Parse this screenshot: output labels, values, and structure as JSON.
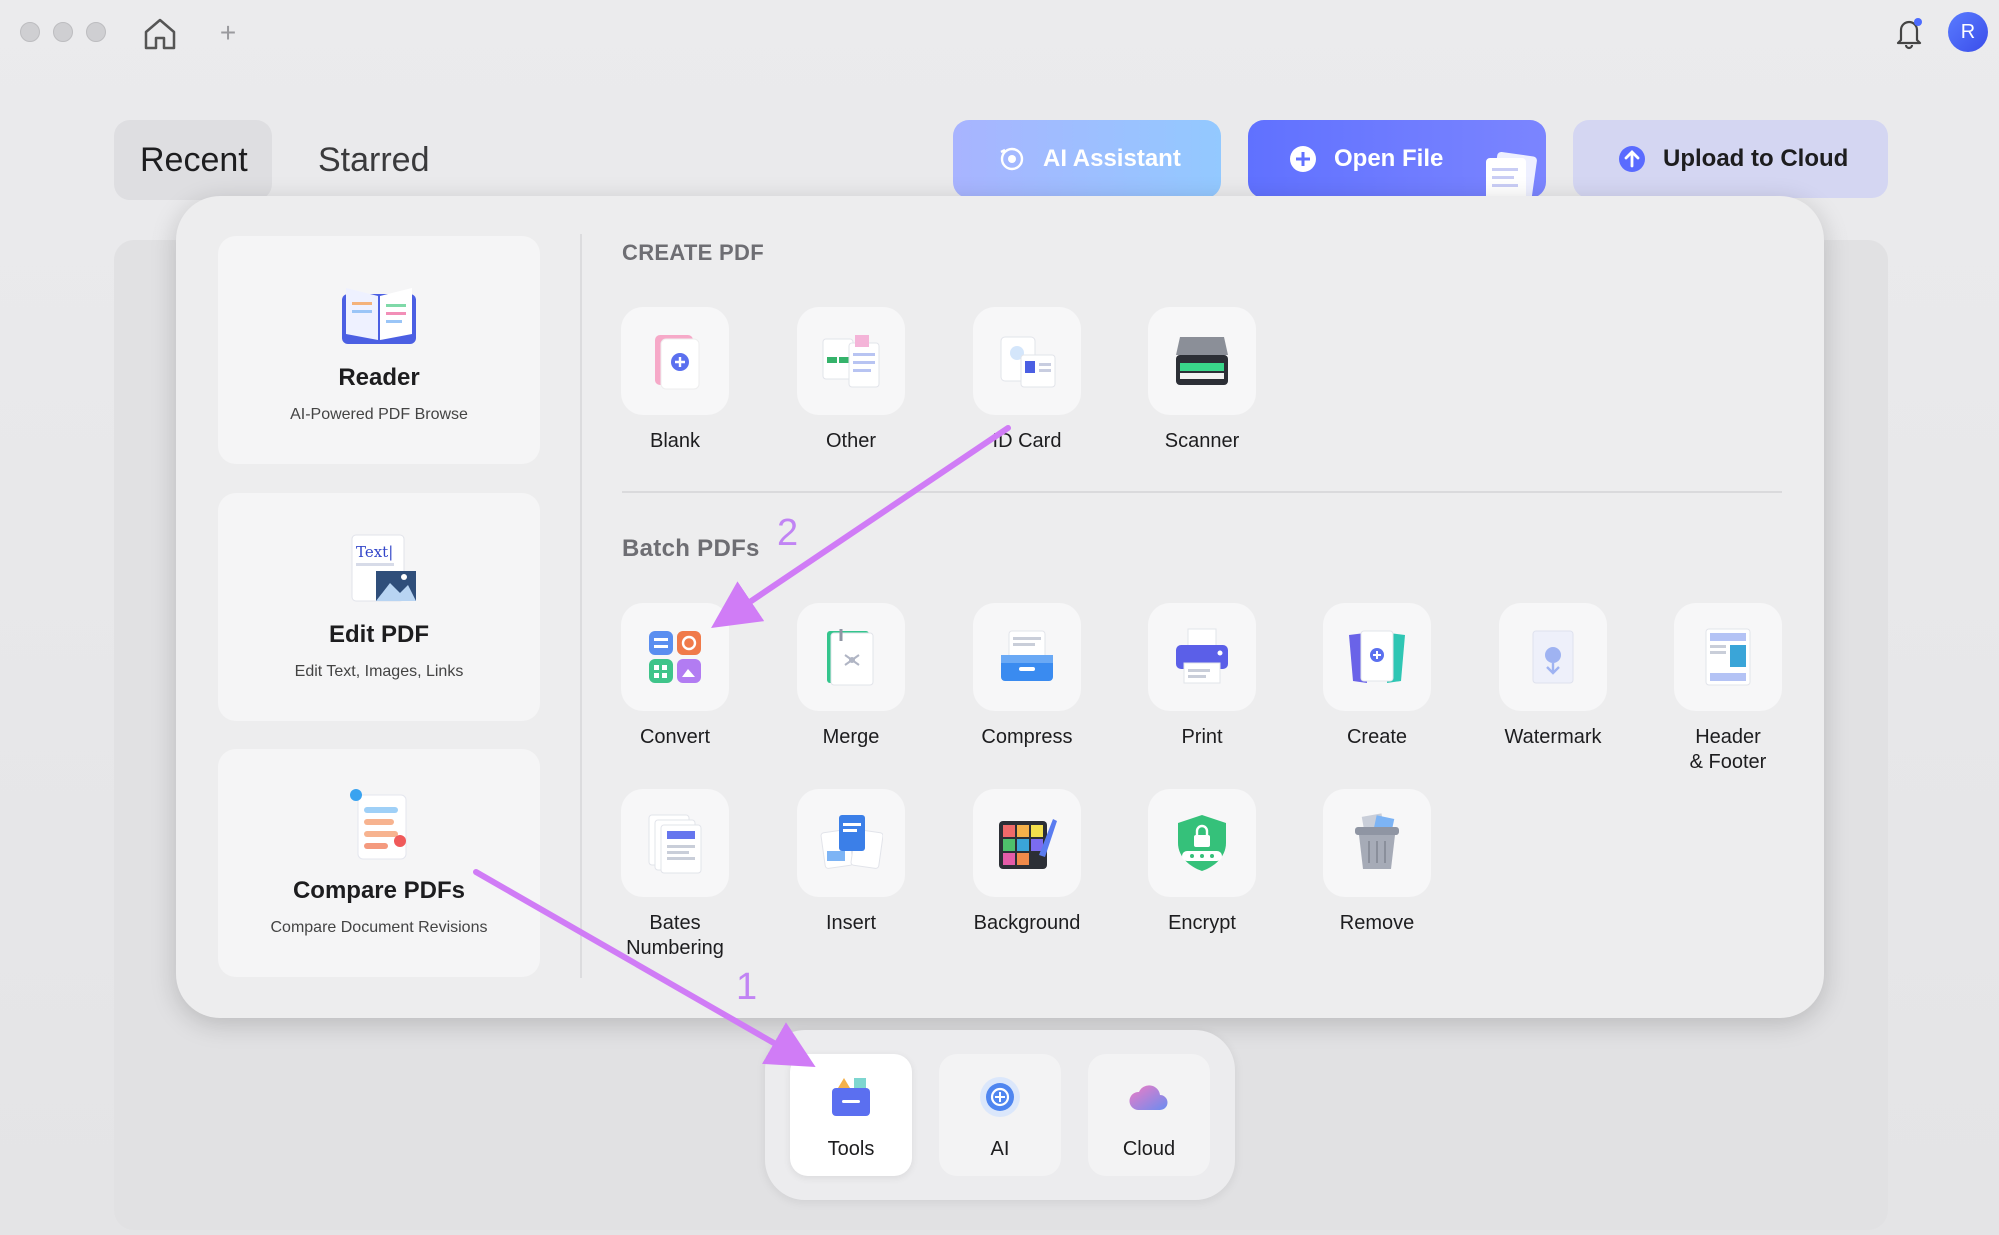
{
  "titlebar": {
    "avatar_initial": "R",
    "icons": [
      "home-icon",
      "plus-icon",
      "bell-icon"
    ]
  },
  "tabs": [
    {
      "label": "Recent",
      "active": true
    },
    {
      "label": "Starred",
      "active": false
    }
  ],
  "actions": {
    "ai_assistant": "AI Assistant",
    "open_file": "Open File",
    "upload_to_cloud": "Upload to Cloud"
  },
  "side_cards": [
    {
      "title": "Reader",
      "subtitle": "AI-Powered PDF Browse",
      "icon": "reader-icon"
    },
    {
      "title": "Edit PDF",
      "subtitle": "Edit Text, Images, Links",
      "icon": "edit-pdf-icon",
      "illustration_text": "Text|"
    },
    {
      "title": "Compare PDFs",
      "subtitle": "Compare Document Revisions",
      "icon": "compare-icon"
    }
  ],
  "create_pdf": {
    "title": "CREATE PDF",
    "items": [
      {
        "label": "Blank",
        "icon": "blank-page-icon"
      },
      {
        "label": "Other",
        "icon": "other-docs-icon"
      },
      {
        "label": "ID Card",
        "icon": "id-card-icon"
      },
      {
        "label": "Scanner",
        "icon": "scanner-icon"
      }
    ]
  },
  "batch_pdfs": {
    "title": "Batch PDFs",
    "items": [
      {
        "label": "Convert",
        "icon": "convert-icon"
      },
      {
        "label": "Merge",
        "icon": "merge-icon"
      },
      {
        "label": "Compress",
        "icon": "compress-icon"
      },
      {
        "label": "Print",
        "icon": "printer-icon"
      },
      {
        "label": "Create",
        "icon": "create-icon"
      },
      {
        "label": "Watermark",
        "icon": "watermark-icon"
      },
      {
        "label": "Header\n& Footer",
        "icon": "header-footer-icon"
      },
      {
        "label": "Bates\nNumbering",
        "icon": "bates-numbering-icon"
      },
      {
        "label": "Insert",
        "icon": "insert-icon"
      },
      {
        "label": "Background",
        "icon": "background-icon"
      },
      {
        "label": "Encrypt",
        "icon": "encrypt-icon"
      },
      {
        "label": "Remove",
        "icon": "trash-icon"
      }
    ]
  },
  "dock": [
    {
      "label": "Tools",
      "icon": "tools-icon",
      "active": true
    },
    {
      "label": "AI",
      "icon": "ai-icon",
      "active": false
    },
    {
      "label": "Cloud",
      "icon": "cloud-icon",
      "active": false
    }
  ],
  "annotations": {
    "step1": "1",
    "step2": "2",
    "arrow_color": "#d07cf6"
  },
  "colors": {
    "ai_gradient": [
      "#a8b4ff",
      "#93c9ff"
    ],
    "open_file": "#6071ff",
    "upload": "#d4d6f2",
    "accent": "#5a6bff"
  }
}
